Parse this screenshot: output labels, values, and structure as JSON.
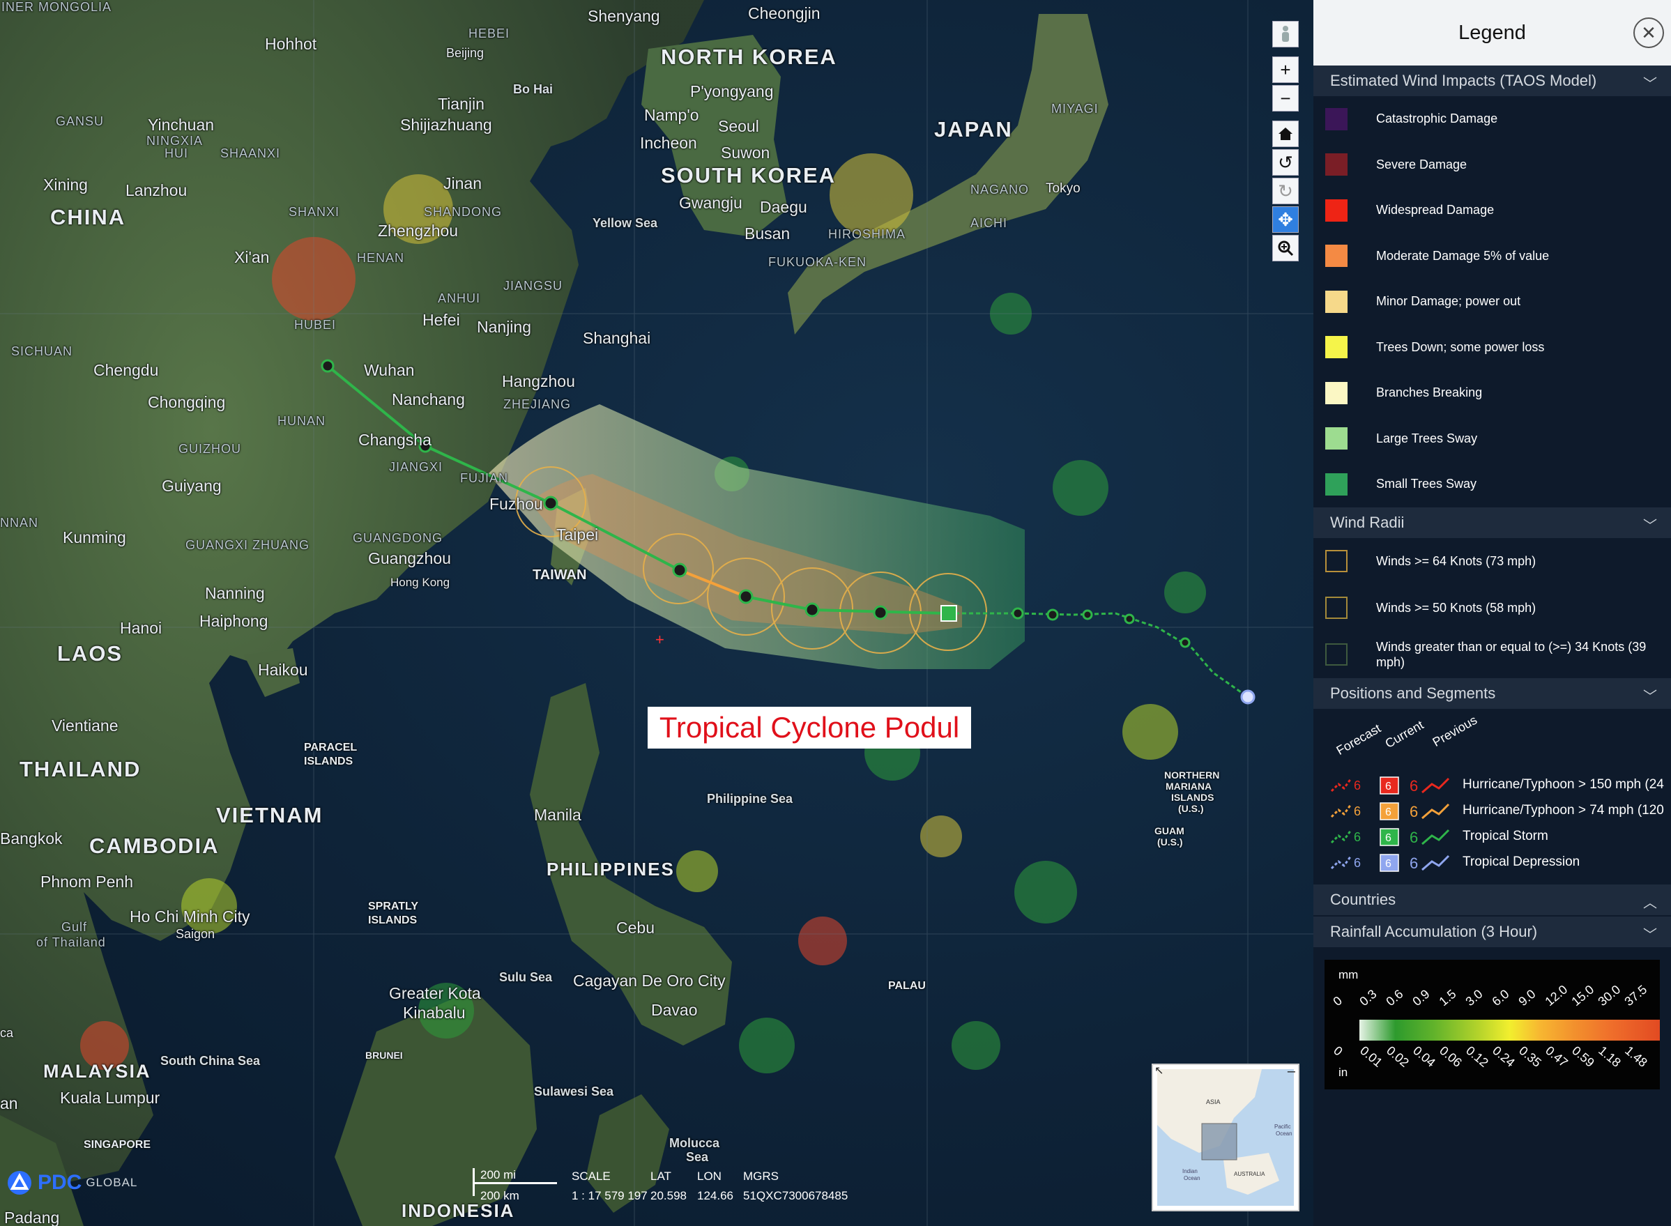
{
  "map": {
    "places": {
      "inner_mongolia": "INER MONGOLIA",
      "shenyang": "Shenyang",
      "cheongjin": "Cheongjin",
      "hebei": "HEBEI",
      "hohhot": "Hohhot",
      "beijing": "Beijing",
      "north_korea": "NORTH KOREA",
      "pyongyang": "P'yongyang",
      "bo_hai": "Bo Hai",
      "tianjin": "Tianjin",
      "gansu": "GANSU",
      "yinchuan": "Yinchuan",
      "ningxia": "NINGXIA",
      "hui": "HUI",
      "shijiazhuang": "Shijiazhuang",
      "nampo": "Namp'o",
      "seoul": "Seoul",
      "incheon": "Incheon",
      "suwon": "Suwon",
      "japan": "JAPAN",
      "miyagi": "MIYAGI",
      "shaanxi": "SHAANXI",
      "south_korea": "SOUTH KOREA",
      "xining": "Xining",
      "lanzhou": "Lanzhou",
      "jinan": "Jinan",
      "gwangju": "Gwangju",
      "daegu": "Daegu",
      "nagano": "NAGANO",
      "tokyo": "Tokyo",
      "china": "CHINA",
      "shanxi": "SHANXI",
      "shandong": "SHANDONG",
      "yellow_sea": "Yellow Sea",
      "busan": "Busan",
      "hiroshima": "HIROSHIMA",
      "aichi": "AICHI",
      "zhengzhou": "Zhengzhou",
      "xian": "Xi'an",
      "henan": "HENAN",
      "fukuoka": "FUKUOKA-KEN",
      "jiangsu": "JIANGSU",
      "anhui": "ANHUI",
      "hubei": "HUBEI",
      "hefei": "Hefei",
      "nanjing": "Nanjing",
      "sichuan": "SICHUAN",
      "shanghai": "Shanghai",
      "chengdu": "Chengdu",
      "wuhan": "Wuhan",
      "hangzhou": "Hangzhou",
      "chongqing": "Chongqing",
      "nanchang": "Nanchang",
      "zhejiang": "ZHEJIANG",
      "hunan": "HUNAN",
      "changsha": "Changsha",
      "guizhou": "GUIZHOU",
      "jiangxi": "JIANGXI",
      "fujian": "FUJIAN",
      "guiyang": "Guiyang",
      "fuzhou": "Fuzhou",
      "nnan": "NNAN",
      "taipei": "Taipei",
      "kunming": "Kunming",
      "guangxi": "GUANGXI ZHUANG",
      "guangdong": "GUANGDONG",
      "guangzhou": "Guangzhou",
      "taiwan": "TAIWAN",
      "hong_kong": "Hong Kong",
      "nanning": "Nanning",
      "hanoi": "Hanoi",
      "haiphong": "Haiphong",
      "laos": "LAOS",
      "haikou": "Haikou",
      "vientiane": "Vientiane",
      "paracel": "PARACEL",
      "islands": "ISLANDS",
      "thailand": "THAILAND",
      "northern_mariana": "NORTHERN",
      "mariana": "MARIANA",
      "islands_us": "ISLANDS",
      "us": "(U.S.)",
      "vietnam": "VIETNAM",
      "manila": "Manila",
      "philippine_sea": "Philippine Sea",
      "bangkok": "Bangkok",
      "cambodia": "CAMBODIA",
      "guam": "GUAM",
      "guam_us": "(U.S.)",
      "philippines": "PHILIPPINES",
      "phnom_penh": "Phnom Penh",
      "spratly": "SPRATLY",
      "spratly_islands": "ISLANDS",
      "hcmc": "Ho Chi Minh City",
      "saigon": "Saigon",
      "gulf": "Gulf",
      "of_thailand": "of Thailand",
      "cebu": "Cebu",
      "sulu_sea": "Sulu Sea",
      "cagayan": "Cagayan De Oro City",
      "palau": "PALAU",
      "greater_kota": "Greater Kota",
      "kinabalu": "Kinabalu",
      "davao": "Davao",
      "malaysia": "MALAYSIA",
      "south_china_sea": "South China Sea",
      "brunei": "BRUNEI",
      "kuala_lumpur": "Kuala Lumpur",
      "sulawesi_sea": "Sulawesi Sea",
      "singapore": "SINGAPORE",
      "molucca": "Molucca",
      "molucca_sea": "Sea",
      "indonesia": "INDONESIA",
      "padang": "Padang",
      "ca": "ca",
      "an": "an"
    },
    "annotation": "Tropical Cyclone Podul",
    "tools": {
      "street_view_icon": "person-icon",
      "zoom_in": "+",
      "zoom_out": "−",
      "home": "⌂",
      "rotate_ccw": "↺",
      "rotate_cw": "↻",
      "pan": "✥",
      "zoom_box": "🔍"
    },
    "scale": {
      "mi": "200 mi",
      "km": "200 km",
      "scale_label": "SCALE",
      "scale_value": "1 : 17 579 197",
      "lat_label": "LAT",
      "lat_value": "20.598",
      "lon_label": "LON",
      "lon_value": "124.66",
      "mgrs_label": "MGRS",
      "mgrs_value": "51QXC7300678485"
    },
    "minimap": {
      "asia": "ASIA",
      "pacific": "Pacific",
      "ocean": "Ocean",
      "indian": "Indian",
      "indian_ocean": "Ocean",
      "australia": "AUSTRALIA"
    },
    "logo": {
      "pdc": "PDC",
      "global": "GLOBAL"
    }
  },
  "legend": {
    "title": "Legend",
    "sections": {
      "taos": "Estimated Wind Impacts (TAOS Model)",
      "wind_radii": "Wind Radii",
      "positions": "Positions and Segments",
      "countries": "Countries",
      "rainfall": "Rainfall Accumulation (3 Hour)"
    },
    "taos_items": [
      {
        "label": "Catastrophic Damage",
        "color": "#3b1658"
      },
      {
        "label": "Severe Damage",
        "color": "#7a1e26"
      },
      {
        "label": "Widespread Damage",
        "color": "#ee2415"
      },
      {
        "label": "Moderate Damage 5% of value",
        "color": "#f48a44"
      },
      {
        "label": "Minor Damage; power out",
        "color": "#f6d98a"
      },
      {
        "label": "Trees Down; some power loss",
        "color": "#f5f44a"
      },
      {
        "label": "Branches Breaking",
        "color": "#fbf7c4"
      },
      {
        "label": "Large Trees Sway",
        "color": "#9ddc90"
      },
      {
        "label": "Small Trees Sway",
        "color": "#2fa15a"
      }
    ],
    "wind_radii_items": [
      {
        "label": "Winds >= 64 Knots (73 mph)",
        "color": "#b8903a"
      },
      {
        "label": "Winds >= 50 Knots (58 mph)",
        "color": "#a48a3a"
      },
      {
        "label": "Winds greater than or equal to (>=) 34 Knots (39 mph)",
        "color": "#3f5a3f"
      }
    ],
    "positions_headers": [
      "Forecast",
      "Current",
      "Previous"
    ],
    "positions_items": [
      {
        "label": "Hurricane/Typhoon > 150 mph (24",
        "color": "#e8281e"
      },
      {
        "label": "Hurricane/Typhoon > 74 mph (120",
        "color": "#f4a13a"
      },
      {
        "label": "Tropical Storm",
        "color": "#2fb54a"
      },
      {
        "label": "Tropical Depression",
        "color": "#8fa6ef"
      }
    ],
    "rain": {
      "unit_top": "mm",
      "unit_bottom": "in",
      "mm_ticks": [
        "0",
        "0.3",
        "0.6",
        "0.9",
        "1.5",
        "3.0",
        "6.0",
        "9.0",
        "12.0",
        "15.0",
        "30.0",
        "37.5"
      ],
      "in_ticks": [
        "0",
        "0.01",
        "0.02",
        "0.04",
        "0.06",
        "0.12",
        "0.24",
        "0.35",
        "0.47",
        "0.59",
        "1.18",
        "1.48"
      ]
    }
  }
}
